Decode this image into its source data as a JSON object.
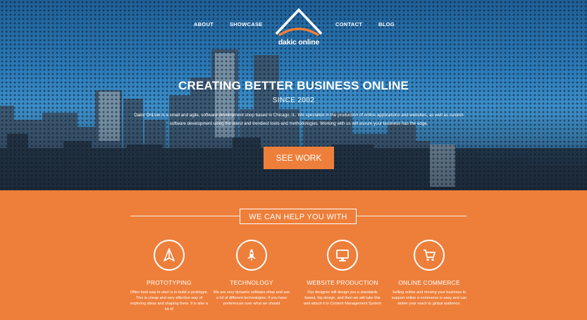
{
  "nav": {
    "left": [
      "ABOUT",
      "SHOWCASE"
    ],
    "right": [
      "CONTACT",
      "BLOG"
    ]
  },
  "logo": {
    "text": "dakic online"
  },
  "hero": {
    "title": "CREATING BETTER BUSINESS ONLINE",
    "subtitle": "SINCE 2002",
    "description": "Dakic OnLine is a small and agile, software development shop based in Chicago, IL. We specialize in the production of online applications and websites, as well as custom software development using the latest and trendiest tools and methodologies. Working with us will assure your business has the edge.",
    "cta": "SEE WORK"
  },
  "help": {
    "heading": "WE CAN HELP YOU WITH"
  },
  "services": [
    {
      "icon": "paper-plane-icon",
      "title": "PROTOTYPING",
      "text": "Often best way to start is to build a prototype. This is cheap and very effective way of exploring ideas and shaping them. It is also a lot of"
    },
    {
      "icon": "rocket-icon",
      "title": "TECHNOLOGY",
      "text": "We are very dynamic software shop and use a lot of different technologies. If you have preferences over what we should"
    },
    {
      "icon": "monitor-icon",
      "title": "WEBSITE PRODUCTION",
      "text": "Our designer will design you a standards based, hip design, and then we will take this and attach it to Content Management System"
    },
    {
      "icon": "shopping-cart-icon",
      "title": "ONLINE COMMERCE",
      "text": "Selling online and moving your business to support online e-commerce is easy and can widen your reach to global audience."
    }
  ],
  "colors": {
    "accent": "#ee7f3a",
    "hero_blue": "#2b79b6",
    "text": "#ffffff"
  }
}
